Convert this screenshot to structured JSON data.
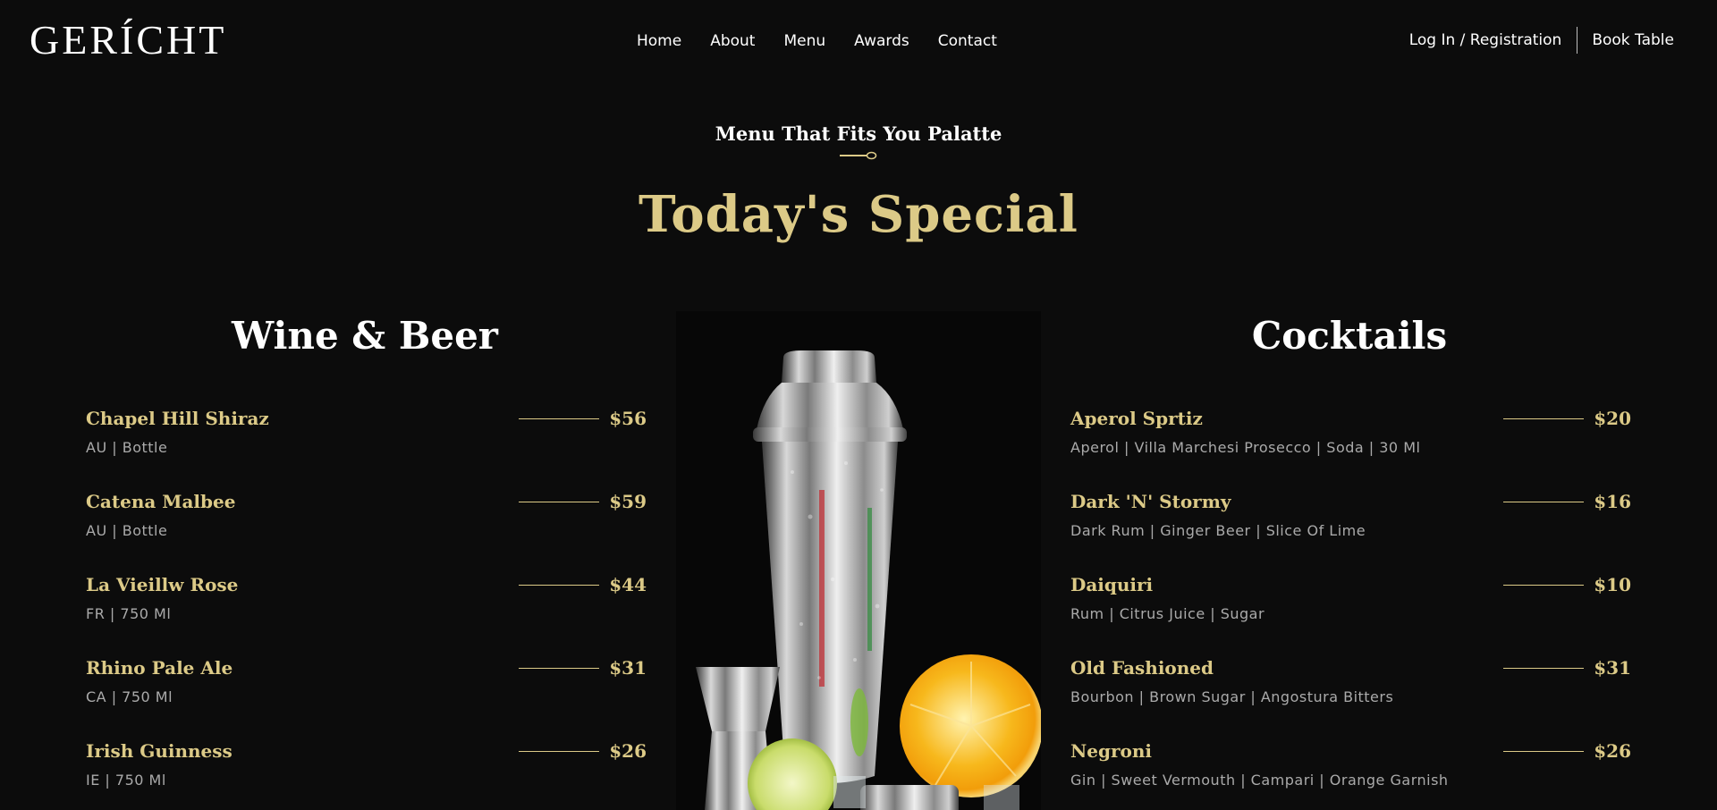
{
  "navbar": {
    "logo": "GERÍCHT",
    "links": [
      "Home",
      "About",
      "Menu",
      "Awards",
      "Contact"
    ],
    "login": "Log In / Registration",
    "book": "Book Table"
  },
  "header": {
    "subtitle": "Menu That Fits You Palatte",
    "title": "Today's Special"
  },
  "wine": {
    "heading": "Wine & Beer",
    "items": [
      {
        "name": "Chapel Hill Shiraz",
        "price": "$56",
        "desc": "AU | Bottle"
      },
      {
        "name": "Catena Malbee",
        "price": "$59",
        "desc": "AU | Bottle"
      },
      {
        "name": "La Vieillw Rose",
        "price": "$44",
        "desc": "FR | 750 Ml"
      },
      {
        "name": "Rhino Pale Ale",
        "price": "$31",
        "desc": "CA | 750 Ml"
      },
      {
        "name": "Irish Guinness",
        "price": "$26",
        "desc": "IE | 750 Ml"
      }
    ]
  },
  "cocktails": {
    "heading": "Cocktails",
    "items": [
      {
        "name": "Aperol Sprtiz",
        "price": "$20",
        "desc": "Aperol | Villa Marchesi Prosecco | Soda | 30 Ml"
      },
      {
        "name": "Dark 'N' Stormy",
        "price": "$16",
        "desc": "Dark Rum | Ginger Beer | Slice Of Lime"
      },
      {
        "name": "Daiquiri",
        "price": "$10",
        "desc": "Rum | Citrus Juice | Sugar"
      },
      {
        "name": "Old Fashioned",
        "price": "$31",
        "desc": "Bourbon | Brown Sugar | Angostura Bitters"
      },
      {
        "name": "Negroni",
        "price": "$26",
        "desc": "Gin | Sweet Vermouth | Campari | Orange Garnish"
      }
    ]
  },
  "colors": {
    "background": "#0c0c0c",
    "gold": "#dcca87",
    "text": "#ffffff",
    "muted": "#aaaaaa"
  },
  "icons": [
    "spoon-divider-icon"
  ]
}
